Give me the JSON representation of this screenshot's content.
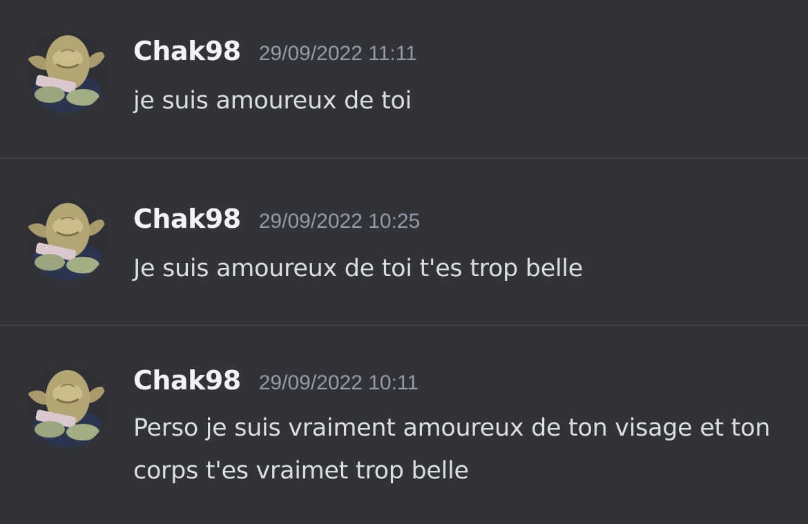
{
  "messages": [
    {
      "username": "Chak98",
      "timestamp": "29/09/2022 11:11",
      "text": "je suis amoureux de toi",
      "avatar": "yoda-avatar"
    },
    {
      "username": "Chak98",
      "timestamp": "29/09/2022 10:25",
      "text": "Je suis amoureux de toi t'es trop belle",
      "avatar": "yoda-avatar"
    },
    {
      "username": "Chak98",
      "timestamp": "29/09/2022 10:11",
      "text": "Perso je suis vraiment amoureux de ton visage et ton corps t'es vraimet trop belle",
      "avatar": "yoda-avatar"
    }
  ],
  "colors": {
    "background": "#313338",
    "divider": "#3f4147",
    "username": "#f2f3f5",
    "timestamp": "#949ba4",
    "message_text": "#dbdee1"
  }
}
